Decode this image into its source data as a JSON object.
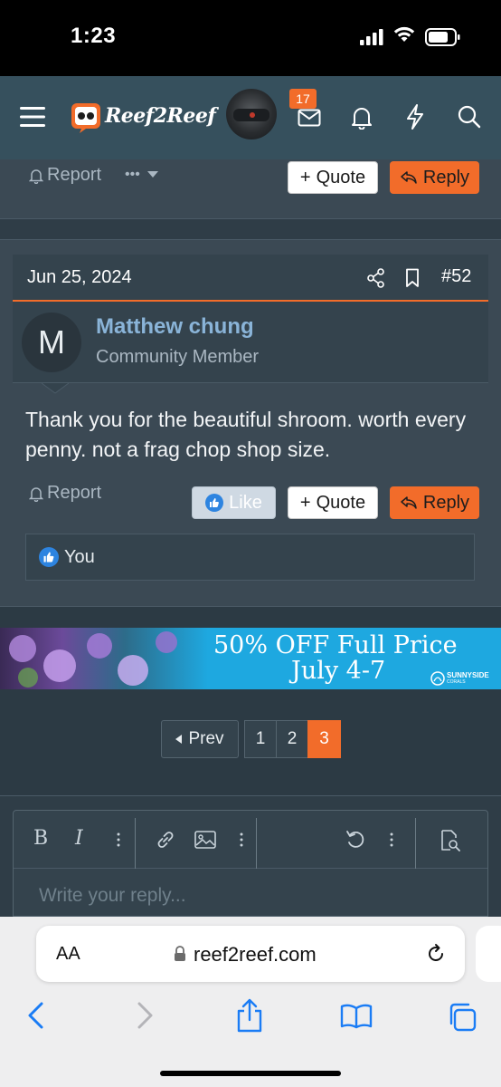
{
  "status_bar": {
    "time": "1:23"
  },
  "navbar": {
    "logo_text": "Reef2Reef",
    "inbox_count": "17",
    "colors": {
      "bg": "#36505d",
      "accent": "#f26c2a"
    }
  },
  "prev_post": {
    "report_label": "Report",
    "more_label": "•••",
    "quote_label": "Quote",
    "reply_label": "Reply"
  },
  "post": {
    "date": "Jun 25, 2024",
    "number": "#52",
    "author": {
      "initial": "M",
      "name": "Matthew chung",
      "title": "Community Member"
    },
    "body": "Thank you for the beautiful shroom. worth every penny. not a frag chop shop size.",
    "report_label": "Report",
    "like_label": "Like",
    "quote_label": "Quote",
    "reply_label": "Reply",
    "reactions_label": "You"
  },
  "ad": {
    "line1": "50% OFF Full Price",
    "line2": "July 4-7",
    "brand": "SUNNYSIDE",
    "brand_sub": "CORALS"
  },
  "pagination": {
    "prev_label": "Prev",
    "pages": [
      "1",
      "2",
      "3"
    ],
    "current": "3"
  },
  "editor": {
    "bold_label": "B",
    "italic_label": "I",
    "placeholder": "Write your reply..."
  },
  "safari": {
    "text_size_label": "AA",
    "url": "reef2reef.com"
  }
}
